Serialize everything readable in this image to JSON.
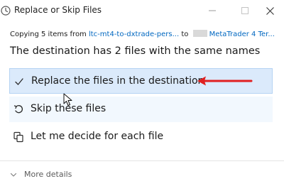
{
  "window": {
    "title": "Replace or Skip Files"
  },
  "copy_info": {
    "prefix": "Copying 5 items from ",
    "source": "ltc-mt4-to-dxtrade-pers...",
    "middle": " to ",
    "destination": "MetaTrader 4 Ter..."
  },
  "heading": "The destination has 2 files with the same names",
  "options": [
    {
      "label": "Replace the files in the destination",
      "icon": "checkmark-icon"
    },
    {
      "label": "Skip these files",
      "icon": "skip-undo-icon"
    },
    {
      "label": "Let me decide for each file",
      "icon": "files-decide-icon"
    }
  ],
  "footer": {
    "more_details": "More details"
  },
  "colors": {
    "accent": "#0067c0",
    "selected_bg": "#dbeafb",
    "hover_bg": "#f2f8fe",
    "annotation": "#e02020"
  }
}
